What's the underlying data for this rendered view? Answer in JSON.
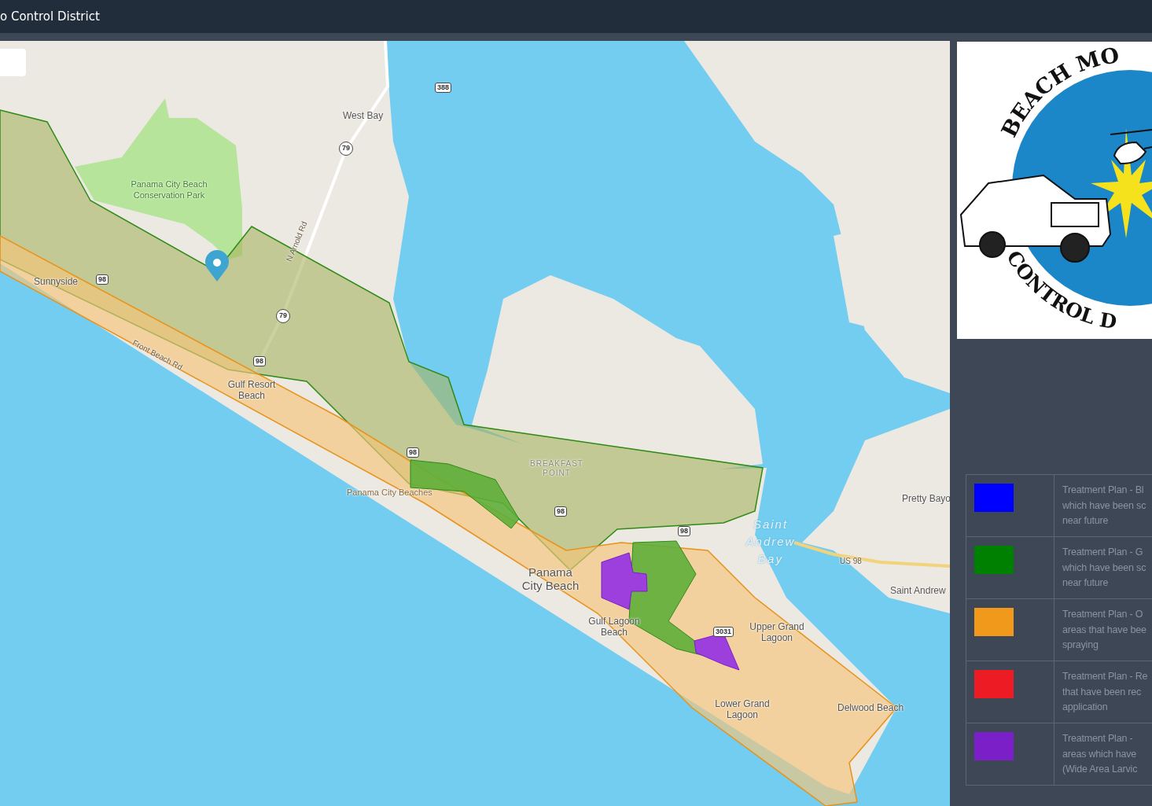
{
  "header": {
    "title": "o Control District"
  },
  "map": {
    "labels": [
      {
        "text": "West Bay",
        "kind": "place"
      },
      {
        "text": "388",
        "kind": "shield"
      },
      {
        "text": "79",
        "kind": "circle-shield"
      },
      {
        "text": "Panama City Beach Conservation Park",
        "kind": "park"
      },
      {
        "text": "N Arnold Rd",
        "kind": "road"
      },
      {
        "text": "Sunnyside",
        "kind": "place"
      },
      {
        "text": "98",
        "kind": "shield"
      },
      {
        "text": "79",
        "kind": "circle-shield"
      },
      {
        "text": "Front Beach Rd",
        "kind": "road"
      },
      {
        "text": "98",
        "kind": "shield"
      },
      {
        "text": "Gulf Resort Beach",
        "kind": "place"
      },
      {
        "text": "98",
        "kind": "shield"
      },
      {
        "text": "BREAKFAST POINT",
        "kind": "district"
      },
      {
        "text": "Panama City Beaches",
        "kind": "small-place"
      },
      {
        "text": "98",
        "kind": "shield"
      },
      {
        "text": "98",
        "kind": "shield"
      },
      {
        "text": "Saint Andrew Bay",
        "kind": "water"
      },
      {
        "text": "Pretty Bayo",
        "kind": "place"
      },
      {
        "text": "US 98",
        "kind": "road"
      },
      {
        "text": "Saint Andrew",
        "kind": "place"
      },
      {
        "text": "Panama City Beach",
        "kind": "city"
      },
      {
        "text": "Gulf Lagoon Beach",
        "kind": "place"
      },
      {
        "text": "3031",
        "kind": "shield"
      },
      {
        "text": "Upper Grand Lagoon",
        "kind": "place"
      },
      {
        "text": "Lower Grand Lagoon",
        "kind": "place"
      },
      {
        "text": "Delwood Beach",
        "kind": "place"
      }
    ]
  },
  "logo": {
    "top_text": "BEACH MO",
    "bottom_text": "CONTROL D"
  },
  "legend": [
    {
      "color": "#0000ff",
      "lines": [
        "Treatment Plan - Bl",
        "which have been sc",
        "near future"
      ]
    },
    {
      "color": "#008000",
      "lines": [
        "Treatment Plan - G",
        "which have been sc",
        "near future"
      ]
    },
    {
      "color": "#f0991a",
      "lines": [
        "Treatment Plan - O",
        "areas that have bee",
        "spraying"
      ]
    },
    {
      "color": "#ed1c24",
      "lines": [
        "Treatment Plan - Re",
        "that have been rec",
        "application"
      ]
    },
    {
      "color": "#7b1fc8",
      "lines": [
        "Treatment Plan -",
        "areas which have",
        "(Wide Area Larvic"
      ]
    }
  ]
}
